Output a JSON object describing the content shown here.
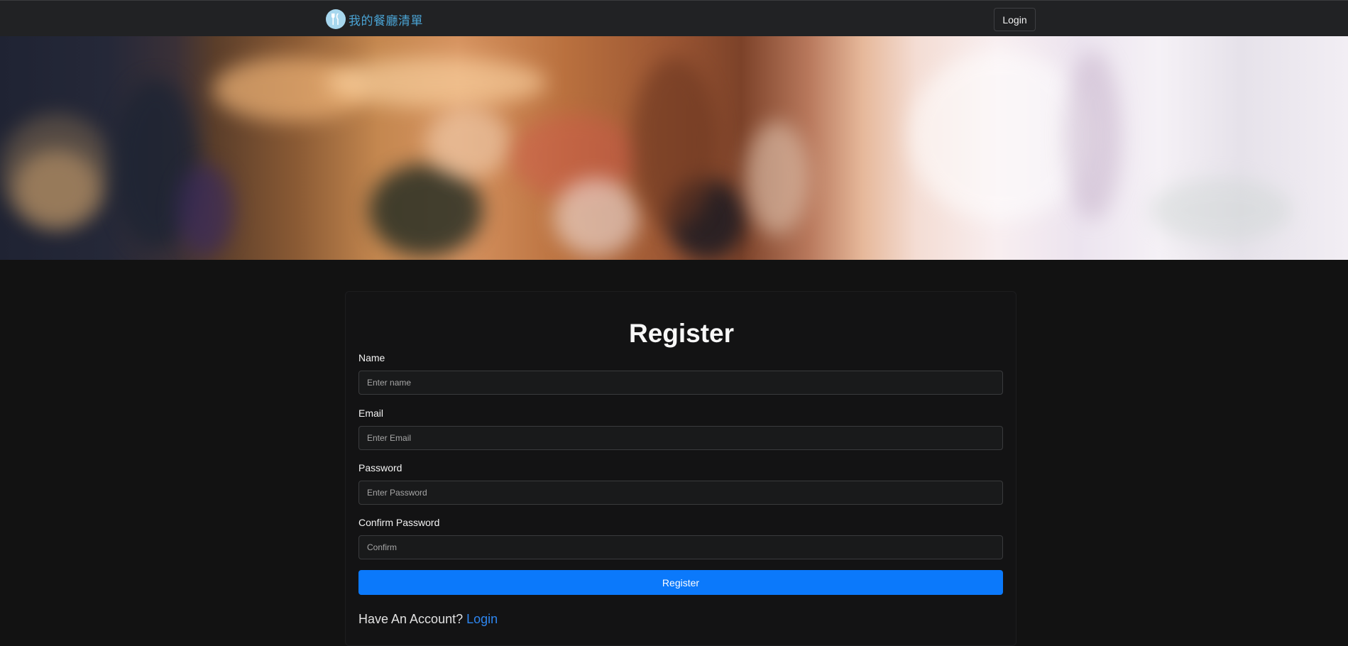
{
  "navbar": {
    "brand_text": "我的餐廳清單",
    "login_label": "Login"
  },
  "hero": {
    "icon": "blurred-restaurant-photo"
  },
  "form": {
    "title": "Register",
    "fields": [
      {
        "label": "Name",
        "placeholder": "Enter name",
        "value": ""
      },
      {
        "label": "Email",
        "placeholder": "Enter Email",
        "value": ""
      },
      {
        "label": "Password",
        "placeholder": "Enter Password",
        "value": ""
      },
      {
        "label": "Confirm Password",
        "placeholder": "Confirm",
        "value": ""
      }
    ],
    "submit_label": "Register",
    "footer_text": "Have An Account?",
    "footer_link": "Login"
  },
  "colors": {
    "background": "#121212",
    "navbar": "#212224",
    "brand": "#4aa3d3",
    "primary": "#0b79fb",
    "link": "#2e86f0"
  }
}
